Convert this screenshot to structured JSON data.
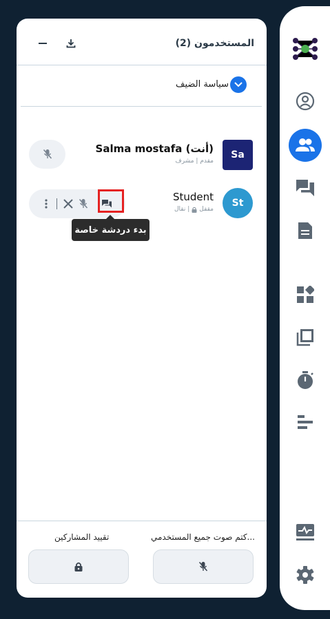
{
  "panel": {
    "title": "المستخدمون (2)",
    "guest_policy_label": "سياسة الضيف"
  },
  "users": [
    {
      "initials": "Sa",
      "name": "Salma mostafa (أنت)",
      "subtitle": "مقدم | مشرف",
      "avatar_color": "#1c2474",
      "avatar_shape": "square"
    },
    {
      "initials": "St",
      "name": "Student",
      "subtitle_a": "نقال |",
      "subtitle_b": "مقفل",
      "avatar_color": "#2d99d0",
      "avatar_shape": "circle"
    }
  ],
  "tooltip": {
    "text": "بدء دردشة خاصة"
  },
  "footer": {
    "mute_all_label": "كتم صوت جميع المستخدمي...",
    "lock_viewers_label": "تقييد المشاركين"
  },
  "sidebar": {
    "items": [
      "logo",
      "user-circle-icon",
      "users-icon",
      "chat-icon",
      "notes-icon",
      "apps-icon",
      "library-icon",
      "timer-icon",
      "poll-icon",
      "health-icon",
      "settings-icon"
    ],
    "active": "users-icon"
  },
  "colors": {
    "accent": "#1a73e8",
    "highlight": "#e52222",
    "background": "#0f2132"
  }
}
